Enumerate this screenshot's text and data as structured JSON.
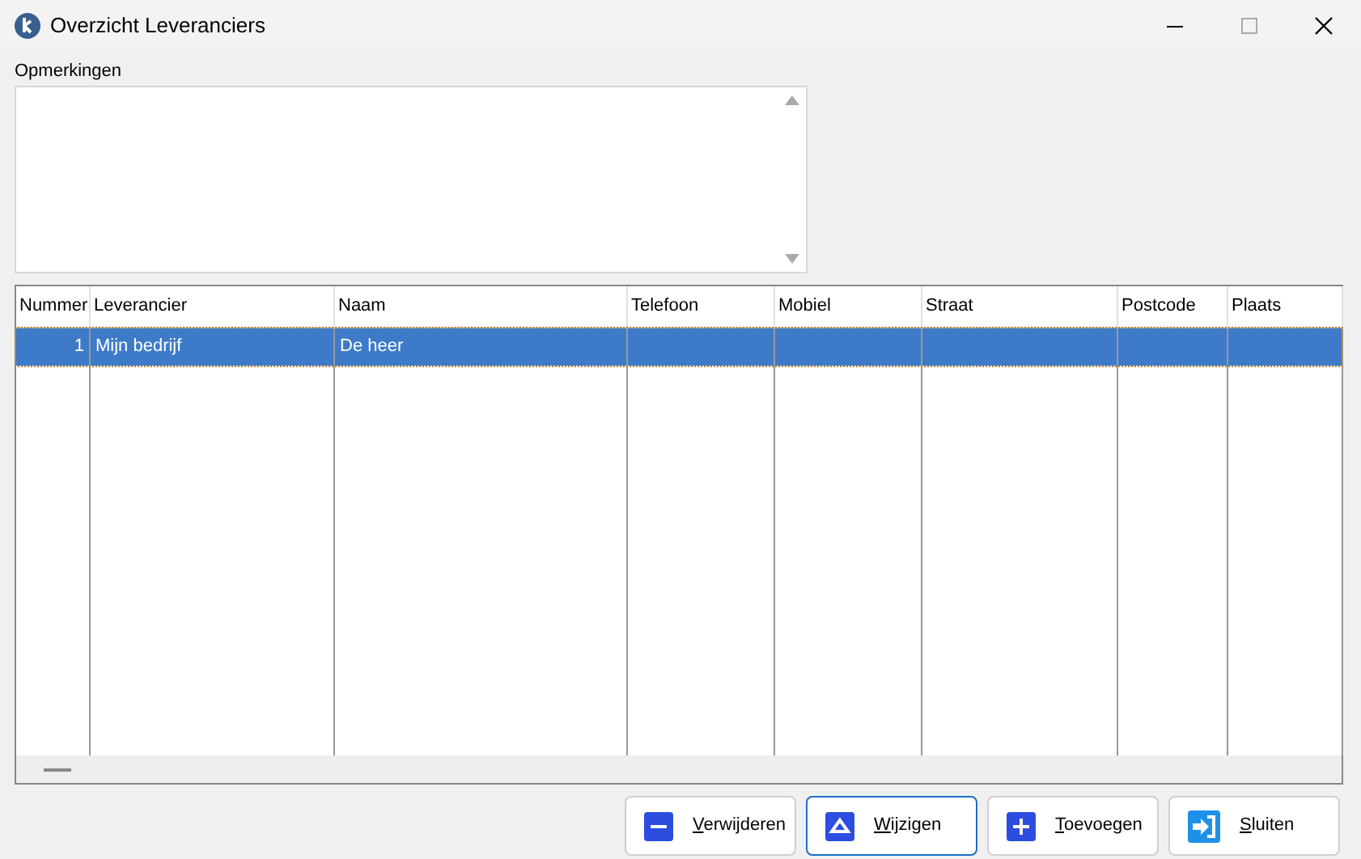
{
  "window": {
    "title": "Overzicht Leveranciers"
  },
  "remarks": {
    "label": "Opmerkingen"
  },
  "table": {
    "columns": [
      "Nummer",
      "Leverancier",
      "Naam",
      "Telefoon",
      "Mobiel",
      "Straat",
      "Postcode",
      "Plaats"
    ],
    "rows": [
      {
        "cells": [
          "1",
          "Mijn bedrijf",
          "De heer",
          "",
          "",
          "",
          "",
          ""
        ],
        "selected": true
      }
    ]
  },
  "buttons": [
    {
      "label": "Verwijderen",
      "kind": "minus",
      "focused": false,
      "accel_first": true
    },
    {
      "label": "Wijzigen",
      "kind": "edit",
      "focused": true,
      "accel_first": true
    },
    {
      "label": "Toevoegen",
      "kind": "plus",
      "focused": false,
      "accel_first": true
    },
    {
      "label": "Sluiten",
      "kind": "exit",
      "focused": false,
      "accel_first": true
    }
  ]
}
